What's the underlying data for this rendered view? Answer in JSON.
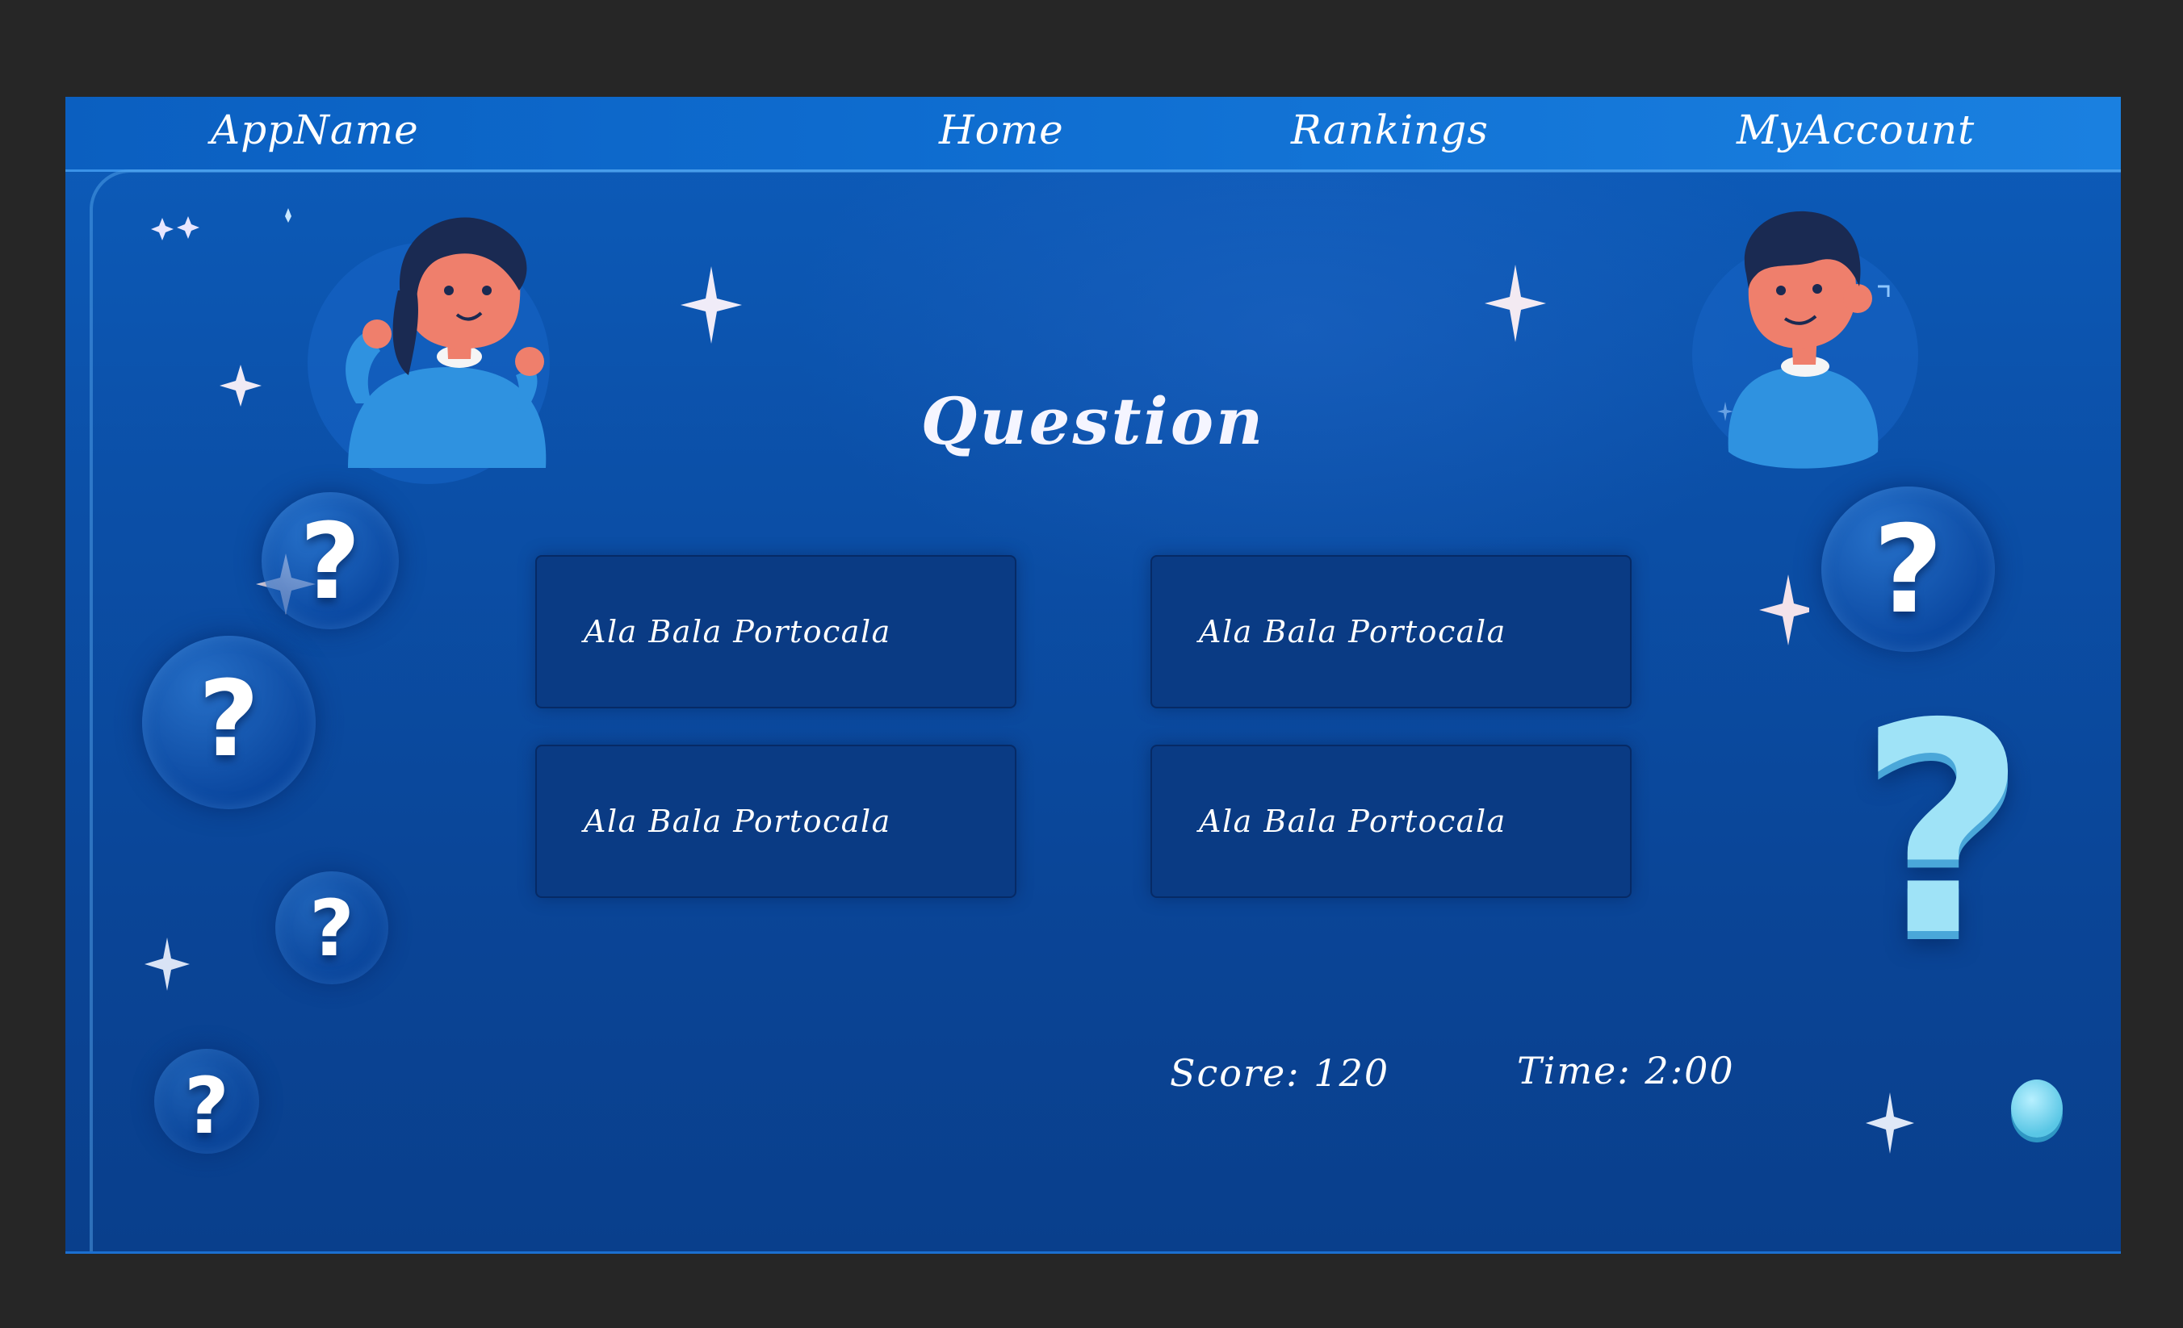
{
  "nav": {
    "app_name": "AppName",
    "home": "Home",
    "rankings": "Rankings",
    "my_account": "MyAccount"
  },
  "quiz": {
    "question": "Question",
    "answers": [
      {
        "label": "Ala Bala Portocala"
      },
      {
        "label": "Ala Bala Portocala"
      },
      {
        "label": "Ala Bala Portocala"
      },
      {
        "label": "Ala Bala Portocala"
      }
    ],
    "score": "Score: 120",
    "time": "Time: 2:00"
  },
  "decor": {
    "question_mark": "?",
    "icons": [
      "girl-avatar-icon",
      "boy-avatar-icon",
      "question-mark-icon",
      "sparkle-icon"
    ]
  },
  "colors": {
    "background": "#0b4fa7",
    "nav": "#0e6ccf",
    "answer_box": "#0a3b84",
    "text": "#ffffff",
    "accent_light": "#9fe3f7"
  }
}
